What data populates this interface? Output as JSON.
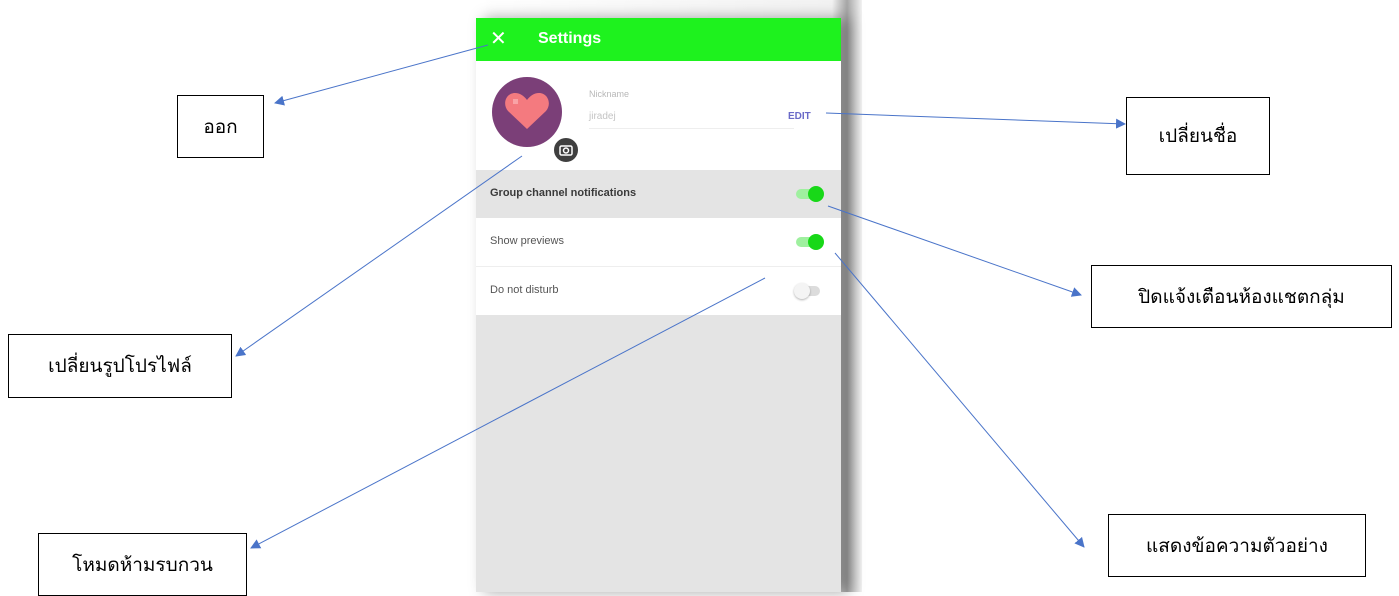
{
  "app": {
    "title": "Settings",
    "close_icon": "close-icon",
    "accent_color": "#1ef21e"
  },
  "profile": {
    "nickname_label": "Nickname",
    "nickname_value": "jiradej",
    "edit_label": "EDIT",
    "avatar_icon": "heart-icon",
    "camera_icon": "camera-icon"
  },
  "settings": {
    "group_notifications": {
      "label": "Group channel notifications",
      "enabled": true
    },
    "show_previews": {
      "label": "Show previews",
      "enabled": true
    },
    "do_not_disturb": {
      "label": "Do not disturb",
      "enabled": false
    }
  },
  "annotations": {
    "exit": "ออก",
    "change_name": "เปลี่ยนชื่อ",
    "change_profile_picture": "เปลี่ยนรูปโปรไฟล์",
    "mute_group_chat": "ปิดแจ้งเตือนห้องแชตกลุ่ม",
    "do_not_disturb_mode": "โหมดห้ามรบกวน",
    "show_message_preview": "แสดงข้อความตัวอย่าง"
  }
}
